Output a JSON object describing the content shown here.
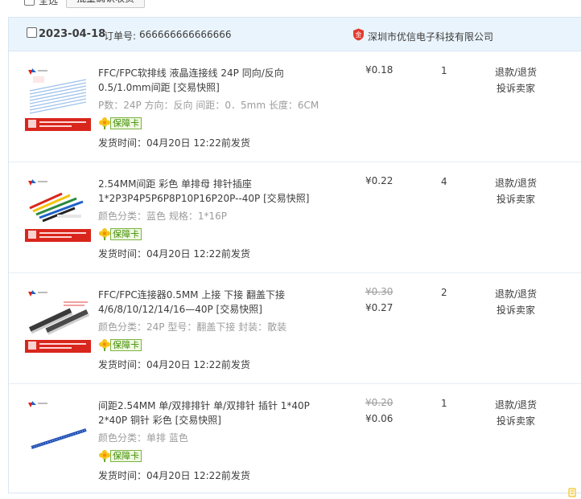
{
  "topbar": {
    "select_all": "全选",
    "batch_confirm": "批量确认收货"
  },
  "order": {
    "date": "2023-04-18",
    "order_no_label": "订单号:",
    "order_no": "666666666666666",
    "shop_name": "深圳市优信电子科技有限公司",
    "items": [
      {
        "title": "FFC/FPC软排线 液晶连接线 24P 同向/反向 0.5/1.0mm间距 [交易快照]",
        "spec": "P数：24P 方向：反向 间距：0．5mm 长度：6CM",
        "badge": "保障卡",
        "ship": "发货时间：04月20日 12:22前发货",
        "price_old": "",
        "price": "¥0.18",
        "qty": "1",
        "action_refund": "退款/退货",
        "action_complain": "投诉卖家"
      },
      {
        "title": "2.54MM间距 彩色 单排母 排针插座 1*2P3P4P5P6P8P10P16P20P--40P [交易快照]",
        "spec": "颜色分类：蓝色 规格：1*16P",
        "badge": "保障卡",
        "ship": "发货时间：04月20日 12:22前发货",
        "price_old": "",
        "price": "¥0.22",
        "qty": "4",
        "action_refund": "退款/退货",
        "action_complain": "投诉卖家"
      },
      {
        "title": "FFC/FPC连接器0.5MM 上接 下接 翻盖下接 4/6/8/10/12/14/16—40P [交易快照]",
        "spec": "颜色分类：24P 型号：翻盖下接 封装：散装",
        "badge": "保障卡",
        "ship": "发货时间：04月20日 12:22前发货",
        "price_old": "¥0.30",
        "price": "¥0.27",
        "qty": "2",
        "action_refund": "退款/退货",
        "action_complain": "投诉卖家"
      },
      {
        "title": "间距2.54MM 单/双排排针 单/双排针 插针 1*40P 2*40P 铜针 彩色 [交易快照]",
        "spec": "颜色分类：单排 蓝色",
        "badge": "保障卡",
        "ship": "发货时间：04月20日 12:22前发货",
        "price_old": "¥0.20",
        "price": "¥0.06",
        "qty": "1",
        "action_refund": "退款/退货",
        "action_complain": "投诉卖家"
      }
    ]
  }
}
